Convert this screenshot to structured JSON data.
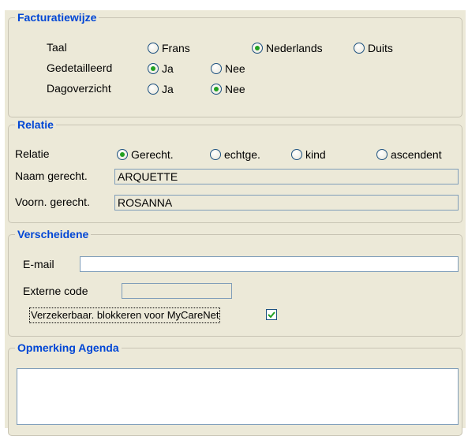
{
  "facturatiewijze": {
    "title": "Facturatiewijze",
    "taal": {
      "label": "Taal",
      "options": [
        "Frans",
        "Nederlands",
        "Duits"
      ],
      "selected": "Nederlands"
    },
    "gedetailleerd": {
      "label": "Gedetailleerd",
      "options": [
        "Ja",
        "Nee"
      ],
      "selected": "Ja"
    },
    "dagoverzicht": {
      "label": "Dagoverzicht",
      "options": [
        "Ja",
        "Nee"
      ],
      "selected": "Nee"
    }
  },
  "relatie": {
    "title": "Relatie",
    "relatie_label": "Relatie",
    "options": [
      "Gerecht.",
      "echtge.",
      "kind",
      "ascendent"
    ],
    "selected": "Gerecht.",
    "naam_label": "Naam gerecht.",
    "naam_value": "ARQUETTE",
    "voornaam_label": "Voorn. gerecht.",
    "voornaam_value": "ROSANNA"
  },
  "verscheidene": {
    "title": "Verscheidene",
    "email_label": "E-mail",
    "email_value": "",
    "externe_code_label": "Externe code",
    "externe_code_value": "",
    "blokkeren_label": "Verzekerbaar. blokkeren voor MyCareNet",
    "blokkeren_checked": true
  },
  "opmerking": {
    "title": "Opmerking Agenda",
    "value": ""
  },
  "colors": {
    "group_title": "#0046d5",
    "panel_bg": "#ece9d8",
    "radio_dot": "#21a121",
    "input_border": "#7f9db9"
  }
}
